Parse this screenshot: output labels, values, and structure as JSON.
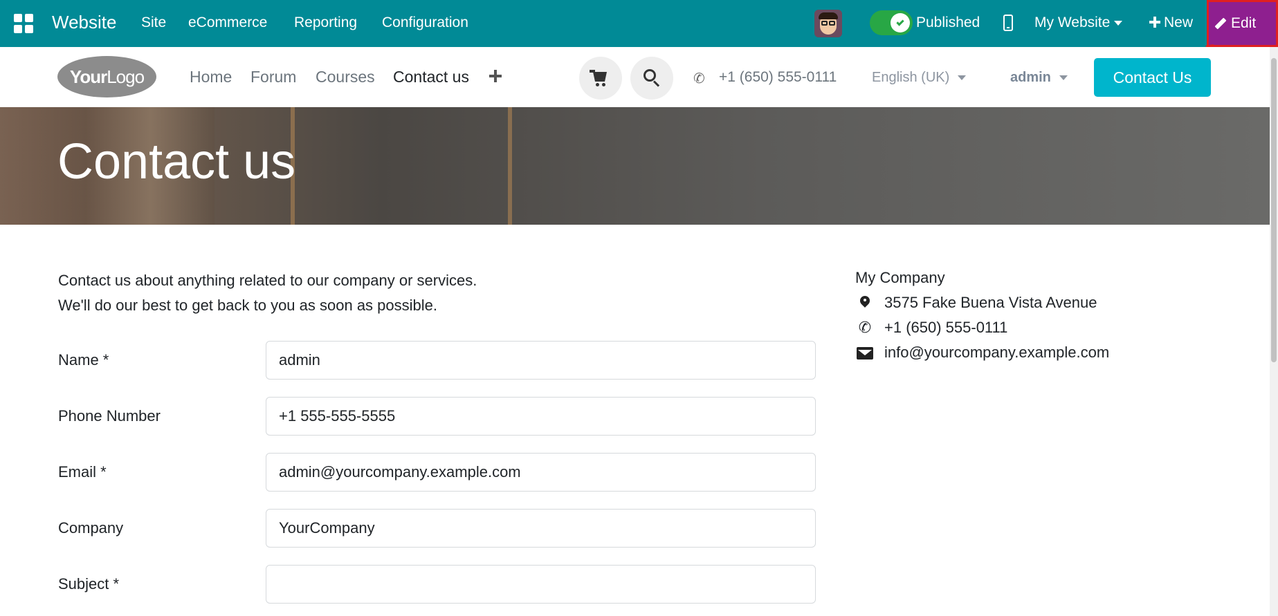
{
  "topbar": {
    "app_title": "Website",
    "menu": [
      "Site",
      "eCommerce",
      "Reporting",
      "Configuration"
    ],
    "published_label": "Published",
    "website_label": "My Website",
    "new_label": "New",
    "edit_label": "Edit",
    "colors": {
      "bar": "#018a96",
      "edit": "#8e1f8f",
      "toggle": "#28a745"
    }
  },
  "header": {
    "logo_bold": "Your",
    "logo_light": "Logo",
    "nav": [
      "Home",
      "Forum",
      "Courses",
      "Contact us"
    ],
    "phone": "+1 (650) 555-0111",
    "language": "English (UK)",
    "user": "admin",
    "contact_button": "Contact Us",
    "colors": {
      "contact_button": "#00b5cc"
    }
  },
  "hero": {
    "title": "Contact us"
  },
  "intro": {
    "line1": "Contact us about anything related to our company or services.",
    "line2": "We'll do our best to get back to you as soon as possible."
  },
  "form": {
    "fields": [
      {
        "label": "Name *",
        "value": "admin"
      },
      {
        "label": "Phone Number",
        "value": "+1 555-555-5555"
      },
      {
        "label": "Email *",
        "value": "admin@yourcompany.example.com"
      },
      {
        "label": "Company",
        "value": "YourCompany"
      },
      {
        "label": "Subject *",
        "value": ""
      }
    ]
  },
  "company": {
    "name": "My Company",
    "address": "3575 Fake Buena Vista Avenue",
    "phone": "+1 (650) 555-0111",
    "email": "info@yourcompany.example.com"
  },
  "icons": [
    "apps-grid-icon",
    "avatar",
    "check-icon",
    "mobile-icon",
    "caret-down-icon",
    "plus-icon",
    "pencil-icon",
    "cart-icon",
    "search-icon",
    "phone-icon",
    "map-marker-icon",
    "envelope-icon"
  ]
}
